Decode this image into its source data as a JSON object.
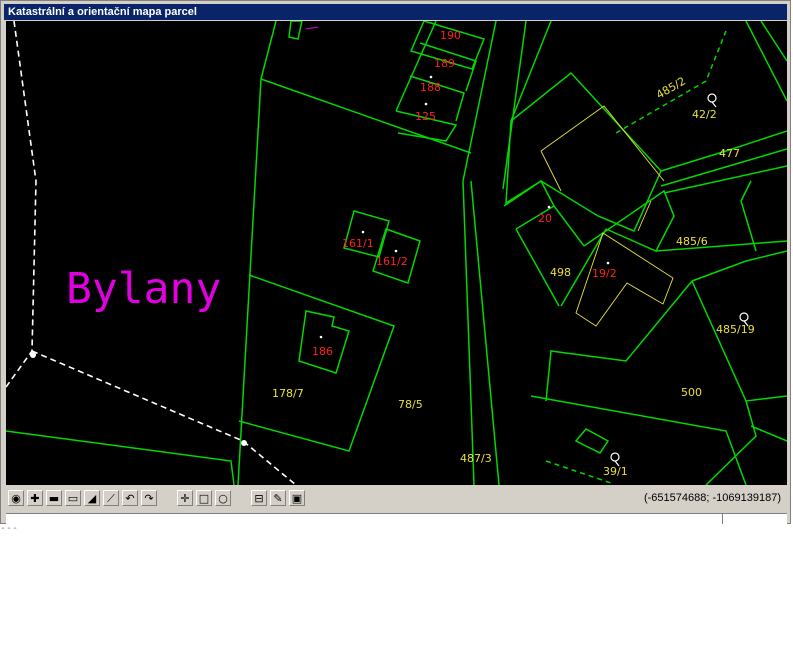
{
  "window": {
    "title": "Katastrální a orientační mapa parcel"
  },
  "map": {
    "town_label": "Bylany",
    "parcels": {
      "p190": "190",
      "p189": "189",
      "p188": "188",
      "p125": "125",
      "p161_1": "161/1",
      "p161_2": "161/2",
      "p186": "186",
      "p20": "20",
      "p19_2": "19/2"
    },
    "land": {
      "l178_7": "178/7",
      "l78_5": "78/5",
      "l487_3": "487/3",
      "l498": "498",
      "l485_6": "485/6",
      "l477": "477",
      "l42_2": "42/2",
      "l485_2": "485/2",
      "l485_19": "485/19",
      "l500": "500",
      "l39_1": "39/1"
    },
    "colors": {
      "background": "#000000",
      "boundary": "#00d800",
      "building_number": "#ff2020",
      "parcel_number": "#e8e040",
      "town_label": "#e000e0",
      "cadastral_border": "#ffffff"
    }
  },
  "toolbar": {
    "tools": [
      "overview-icon",
      "zoom-in-icon",
      "zoom-out-icon",
      "zoom-window-icon",
      "pan-icon",
      "measure-line-icon",
      "undo-icon",
      "redo-icon",
      "identify-point-icon",
      "select-rectangle-icon",
      "select-polygon-icon",
      "ruler-icon",
      "draw-icon",
      "print-icon"
    ],
    "coordinates": "(-651574688; -1069139187)"
  },
  "footer": {
    "dashes": "---"
  }
}
